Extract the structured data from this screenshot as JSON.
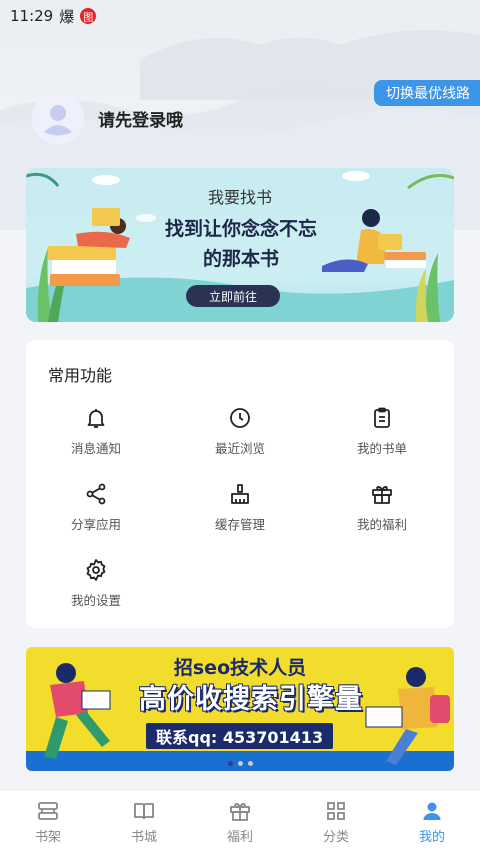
{
  "status_bar": {
    "time": "11:29",
    "icon_1": "爆",
    "icon_2": "图"
  },
  "header": {
    "switch_route_label": "切换最优线路",
    "login_prompt": "请先登录哦"
  },
  "find_banner": {
    "title": "我要找书",
    "headline_1": "找到让你念念不忘",
    "headline_2": "的那本书",
    "button_label": "立即前往"
  },
  "features": {
    "title": "常用功能",
    "items": [
      {
        "label": "消息通知",
        "icon": "bell-icon"
      },
      {
        "label": "最近浏览",
        "icon": "clock-icon"
      },
      {
        "label": "我的书单",
        "icon": "clipboard-icon"
      },
      {
        "label": "分享应用",
        "icon": "share-icon"
      },
      {
        "label": "缓存管理",
        "icon": "broom-icon"
      },
      {
        "label": "我的福利",
        "icon": "gift-icon"
      },
      {
        "label": "我的设置",
        "icon": "gear-icon"
      }
    ]
  },
  "ad_banner": {
    "line1": "招seo技术人员",
    "line2": "高价收搜索引擎量",
    "line3": "联系qq: 453701413"
  },
  "tabs": [
    {
      "label": "书架",
      "icon": "bookshelf-icon",
      "active": false
    },
    {
      "label": "书城",
      "icon": "open-book-icon",
      "active": false
    },
    {
      "label": "福利",
      "icon": "gift-icon",
      "active": false
    },
    {
      "label": "分类",
      "icon": "grid-icon",
      "active": false
    },
    {
      "label": "我的",
      "icon": "person-icon",
      "active": true
    }
  ],
  "colors": {
    "accent": "#3c95e8",
    "banner_navy": "#2b3354",
    "ad_yellow": "#f2dc2c"
  }
}
